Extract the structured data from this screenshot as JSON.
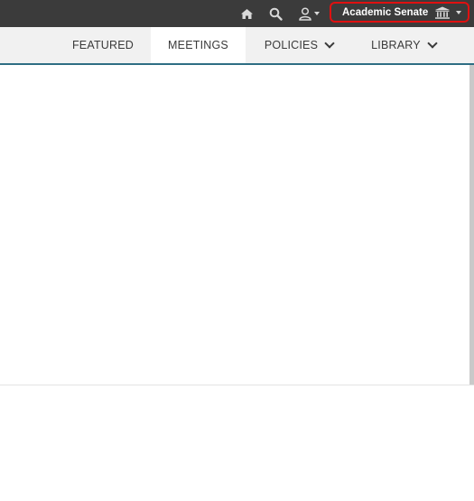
{
  "topbar": {
    "icons": [
      "home-icon",
      "search-icon",
      "user-icon",
      "dropdown-caret-icon",
      "institution-icon"
    ],
    "org_switcher": {
      "label": "Academic Senate",
      "highlight_color": "#e01010"
    }
  },
  "navbar": {
    "items": [
      {
        "label": "FEATURED",
        "active": false,
        "has_dropdown": false
      },
      {
        "label": "MEETINGS",
        "active": true,
        "has_dropdown": false
      },
      {
        "label": "POLICIES",
        "active": false,
        "has_dropdown": true
      },
      {
        "label": "LIBRARY",
        "active": false,
        "has_dropdown": true
      }
    ],
    "accent_color": "#2e6e84"
  },
  "colors": {
    "topbar_bg": "#3b3b3b",
    "navbar_bg": "#f1f1f1"
  }
}
